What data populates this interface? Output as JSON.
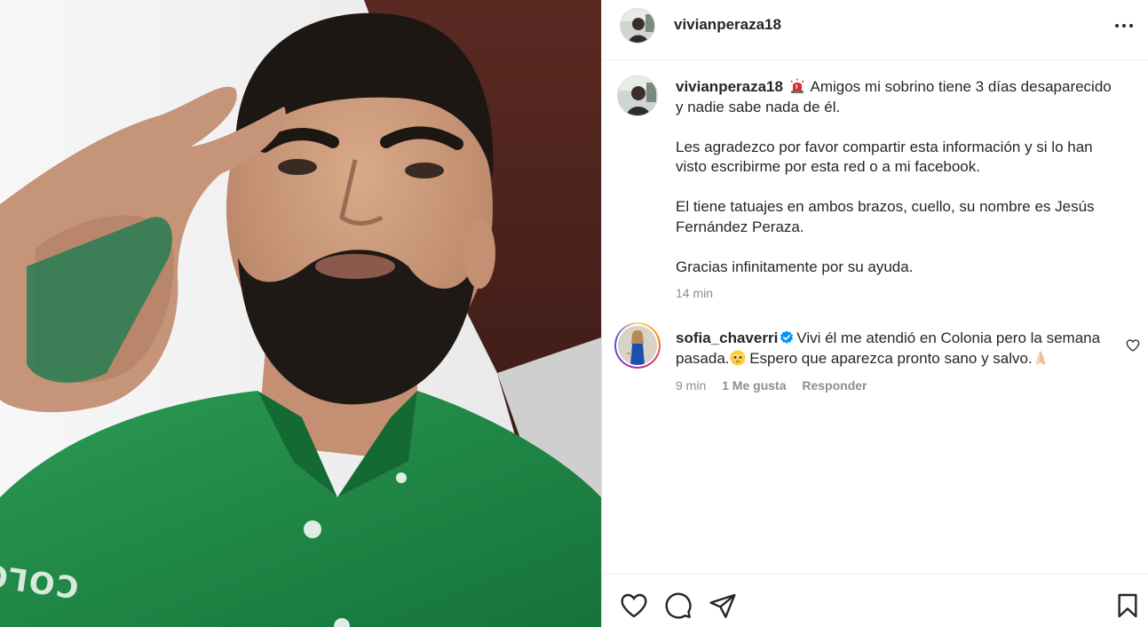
{
  "post": {
    "username": "vivianperaza18",
    "caption_lines": [
      "Amigos mi sobrino tiene 3 días desaparecido y nadie sabe nada de él.",
      "Les agradezco por favor compartir esta información y si lo han visto escribirme por esta red o a mi facebook.",
      "El tiene tatuajes en ambos brazos, cuello, su nombre es Jesús Fernández Peraza.",
      "Gracias infinitamente por su ayuda."
    ],
    "caption_time": "14 min",
    "photo_shirt_text": "COLONIA"
  },
  "comment": {
    "username": "sofia_chaverri",
    "text_part1": "Vivi él me atendió en Colonia pero la semana pasada.",
    "text_part2": " Espero que aparezca pronto sano y salvo.",
    "time": "9 min",
    "likes": "1 Me gusta",
    "reply": "Responder"
  },
  "icons": {
    "more": "more-icon",
    "siren": "siren-icon",
    "verified": "verified-icon",
    "heart": "heart-icon",
    "comment": "comment-icon",
    "share": "share-icon",
    "save": "bookmark-icon"
  },
  "colors": {
    "text": "#262626",
    "secondary": "#8e8e8e",
    "verified": "#0095f6",
    "shirt_green": "#1f8a45"
  }
}
